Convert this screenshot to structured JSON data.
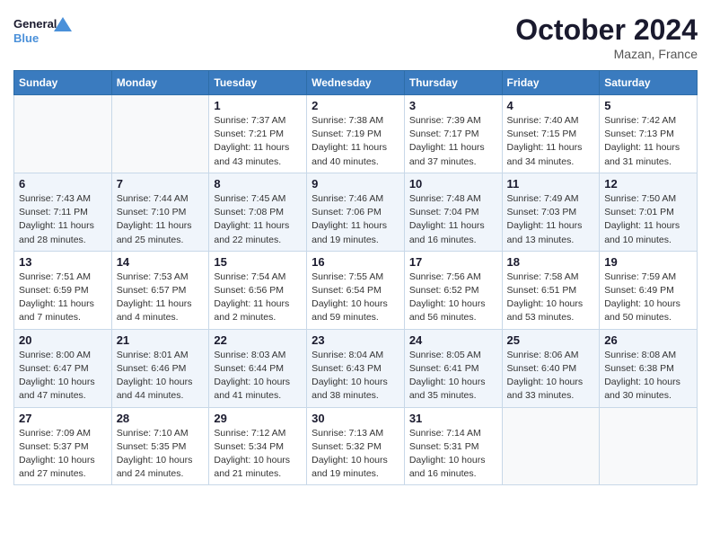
{
  "header": {
    "logo_line1": "General",
    "logo_line2": "Blue",
    "month": "October 2024",
    "location": "Mazan, France"
  },
  "weekdays": [
    "Sunday",
    "Monday",
    "Tuesday",
    "Wednesday",
    "Thursday",
    "Friday",
    "Saturday"
  ],
  "weeks": [
    [
      {
        "day": "",
        "info": ""
      },
      {
        "day": "",
        "info": ""
      },
      {
        "day": "1",
        "info": "Sunrise: 7:37 AM\nSunset: 7:21 PM\nDaylight: 11 hours and 43 minutes."
      },
      {
        "day": "2",
        "info": "Sunrise: 7:38 AM\nSunset: 7:19 PM\nDaylight: 11 hours and 40 minutes."
      },
      {
        "day": "3",
        "info": "Sunrise: 7:39 AM\nSunset: 7:17 PM\nDaylight: 11 hours and 37 minutes."
      },
      {
        "day": "4",
        "info": "Sunrise: 7:40 AM\nSunset: 7:15 PM\nDaylight: 11 hours and 34 minutes."
      },
      {
        "day": "5",
        "info": "Sunrise: 7:42 AM\nSunset: 7:13 PM\nDaylight: 11 hours and 31 minutes."
      }
    ],
    [
      {
        "day": "6",
        "info": "Sunrise: 7:43 AM\nSunset: 7:11 PM\nDaylight: 11 hours and 28 minutes."
      },
      {
        "day": "7",
        "info": "Sunrise: 7:44 AM\nSunset: 7:10 PM\nDaylight: 11 hours and 25 minutes."
      },
      {
        "day": "8",
        "info": "Sunrise: 7:45 AM\nSunset: 7:08 PM\nDaylight: 11 hours and 22 minutes."
      },
      {
        "day": "9",
        "info": "Sunrise: 7:46 AM\nSunset: 7:06 PM\nDaylight: 11 hours and 19 minutes."
      },
      {
        "day": "10",
        "info": "Sunrise: 7:48 AM\nSunset: 7:04 PM\nDaylight: 11 hours and 16 minutes."
      },
      {
        "day": "11",
        "info": "Sunrise: 7:49 AM\nSunset: 7:03 PM\nDaylight: 11 hours and 13 minutes."
      },
      {
        "day": "12",
        "info": "Sunrise: 7:50 AM\nSunset: 7:01 PM\nDaylight: 11 hours and 10 minutes."
      }
    ],
    [
      {
        "day": "13",
        "info": "Sunrise: 7:51 AM\nSunset: 6:59 PM\nDaylight: 11 hours and 7 minutes."
      },
      {
        "day": "14",
        "info": "Sunrise: 7:53 AM\nSunset: 6:57 PM\nDaylight: 11 hours and 4 minutes."
      },
      {
        "day": "15",
        "info": "Sunrise: 7:54 AM\nSunset: 6:56 PM\nDaylight: 11 hours and 2 minutes."
      },
      {
        "day": "16",
        "info": "Sunrise: 7:55 AM\nSunset: 6:54 PM\nDaylight: 10 hours and 59 minutes."
      },
      {
        "day": "17",
        "info": "Sunrise: 7:56 AM\nSunset: 6:52 PM\nDaylight: 10 hours and 56 minutes."
      },
      {
        "day": "18",
        "info": "Sunrise: 7:58 AM\nSunset: 6:51 PM\nDaylight: 10 hours and 53 minutes."
      },
      {
        "day": "19",
        "info": "Sunrise: 7:59 AM\nSunset: 6:49 PM\nDaylight: 10 hours and 50 minutes."
      }
    ],
    [
      {
        "day": "20",
        "info": "Sunrise: 8:00 AM\nSunset: 6:47 PM\nDaylight: 10 hours and 47 minutes."
      },
      {
        "day": "21",
        "info": "Sunrise: 8:01 AM\nSunset: 6:46 PM\nDaylight: 10 hours and 44 minutes."
      },
      {
        "day": "22",
        "info": "Sunrise: 8:03 AM\nSunset: 6:44 PM\nDaylight: 10 hours and 41 minutes."
      },
      {
        "day": "23",
        "info": "Sunrise: 8:04 AM\nSunset: 6:43 PM\nDaylight: 10 hours and 38 minutes."
      },
      {
        "day": "24",
        "info": "Sunrise: 8:05 AM\nSunset: 6:41 PM\nDaylight: 10 hours and 35 minutes."
      },
      {
        "day": "25",
        "info": "Sunrise: 8:06 AM\nSunset: 6:40 PM\nDaylight: 10 hours and 33 minutes."
      },
      {
        "day": "26",
        "info": "Sunrise: 8:08 AM\nSunset: 6:38 PM\nDaylight: 10 hours and 30 minutes."
      }
    ],
    [
      {
        "day": "27",
        "info": "Sunrise: 7:09 AM\nSunset: 5:37 PM\nDaylight: 10 hours and 27 minutes."
      },
      {
        "day": "28",
        "info": "Sunrise: 7:10 AM\nSunset: 5:35 PM\nDaylight: 10 hours and 24 minutes."
      },
      {
        "day": "29",
        "info": "Sunrise: 7:12 AM\nSunset: 5:34 PM\nDaylight: 10 hours and 21 minutes."
      },
      {
        "day": "30",
        "info": "Sunrise: 7:13 AM\nSunset: 5:32 PM\nDaylight: 10 hours and 19 minutes."
      },
      {
        "day": "31",
        "info": "Sunrise: 7:14 AM\nSunset: 5:31 PM\nDaylight: 10 hours and 16 minutes."
      },
      {
        "day": "",
        "info": ""
      },
      {
        "day": "",
        "info": ""
      }
    ]
  ]
}
